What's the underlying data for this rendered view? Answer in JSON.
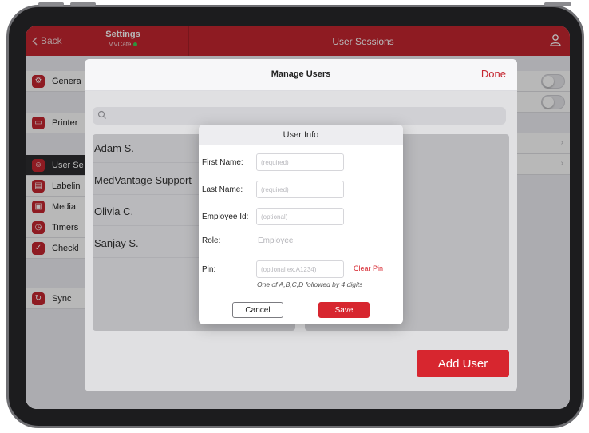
{
  "navbar": {
    "back_label": "Back",
    "settings_title": "Settings",
    "settings_subtitle": "MVCafe",
    "title": "User Sessions",
    "icons": {
      "back": "chevron-left-icon",
      "user": "user-icon"
    },
    "bar_color": "#c52630"
  },
  "sidebar": {
    "items": [
      {
        "label": "Genera",
        "icon": "gear-icon"
      },
      {
        "label": "Printer",
        "icon": "printer-icon"
      },
      {
        "label": "User Se",
        "icon": "user-icon"
      },
      {
        "label": "Labelin",
        "icon": "label-icon"
      },
      {
        "label": "Media",
        "icon": "media-icon"
      },
      {
        "label": "Timers",
        "icon": "timer-icon"
      },
      {
        "label": "Checkl",
        "icon": "checklist-icon"
      },
      {
        "label": "Sync",
        "icon": "sync-icon"
      }
    ]
  },
  "manage_users": {
    "title": "Manage Users",
    "done_label": "Done",
    "search": {
      "placeholder": ""
    },
    "users": [
      "Adam S.",
      "MedVantage Support",
      "Olivia C.",
      "Sanjay S."
    ],
    "add_user_label": "Add User"
  },
  "user_info": {
    "title": "User Info",
    "fields": {
      "first_name": {
        "label": "First Name:",
        "placeholder": "(required)",
        "value": ""
      },
      "last_name": {
        "label": "Last Name:",
        "placeholder": "(required)",
        "value": ""
      },
      "employee_id": {
        "label": "Employee Id:",
        "placeholder": "(optional)",
        "value": ""
      },
      "role": {
        "label": "Role:",
        "value": "Employee"
      },
      "pin": {
        "label": "Pin:",
        "placeholder": "(optional ex.A1234)",
        "value": ""
      }
    },
    "clear_pin_label": "Clear Pin",
    "pin_hint": "One of A,B,C,D followed by 4 digits",
    "cancel_label": "Cancel",
    "save_label": "Save"
  },
  "colors": {
    "accent": "#d7262f",
    "online": "#3fcf55"
  }
}
